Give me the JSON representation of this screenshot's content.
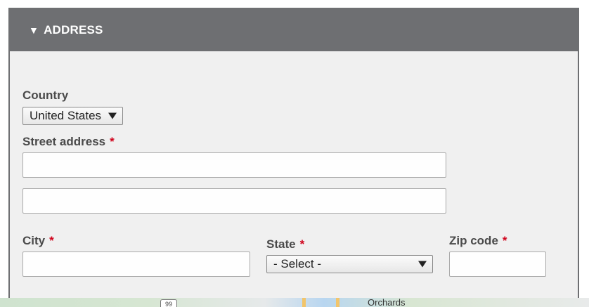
{
  "section": {
    "title": "ADDRESS",
    "toggle_glyph": "▼"
  },
  "country": {
    "label": "Country",
    "selected": "United States"
  },
  "street": {
    "label": "Street address",
    "required_mark": "*",
    "line1_value": "",
    "line2_value": ""
  },
  "city": {
    "label": "City",
    "required_mark": "*",
    "value": ""
  },
  "state": {
    "label": "State",
    "required_mark": "*",
    "selected": "- Select -"
  },
  "zip": {
    "label": "Zip code",
    "required_mark": "*",
    "value": ""
  },
  "map": {
    "place_label": "Orchards",
    "route_shield": "99"
  },
  "colors": {
    "header_bg": "#6e6f72",
    "panel_bg": "#f0f0f0",
    "required": "#d0021b"
  }
}
